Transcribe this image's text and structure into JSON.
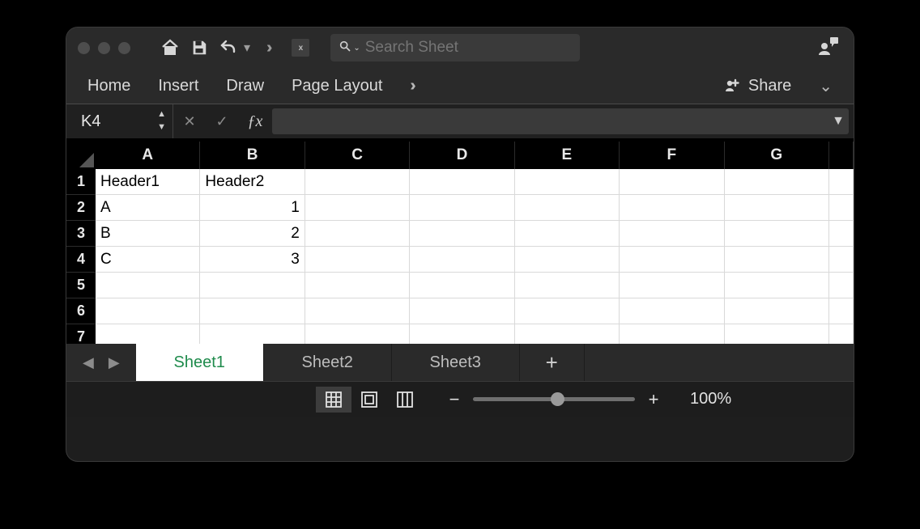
{
  "search": {
    "placeholder": "Search Sheet"
  },
  "ribbon": {
    "tabs": [
      "Home",
      "Insert",
      "Draw",
      "Page Layout"
    ],
    "share": "Share"
  },
  "formula_bar": {
    "name_box": "K4",
    "formula": ""
  },
  "columns": [
    "A",
    "B",
    "C",
    "D",
    "E",
    "F",
    "G"
  ],
  "row_numbers": [
    "1",
    "2",
    "3",
    "4",
    "5",
    "6",
    "7"
  ],
  "cells": {
    "A1": "Header1",
    "B1": "Header2",
    "A2": "A",
    "B2": "1",
    "A3": "B",
    "B3": "2",
    "A4": "C",
    "B4": "3"
  },
  "sheet_tabs": [
    "Sheet1",
    "Sheet2",
    "Sheet3"
  ],
  "active_sheet_index": 0,
  "status": {
    "zoom": "100%"
  }
}
